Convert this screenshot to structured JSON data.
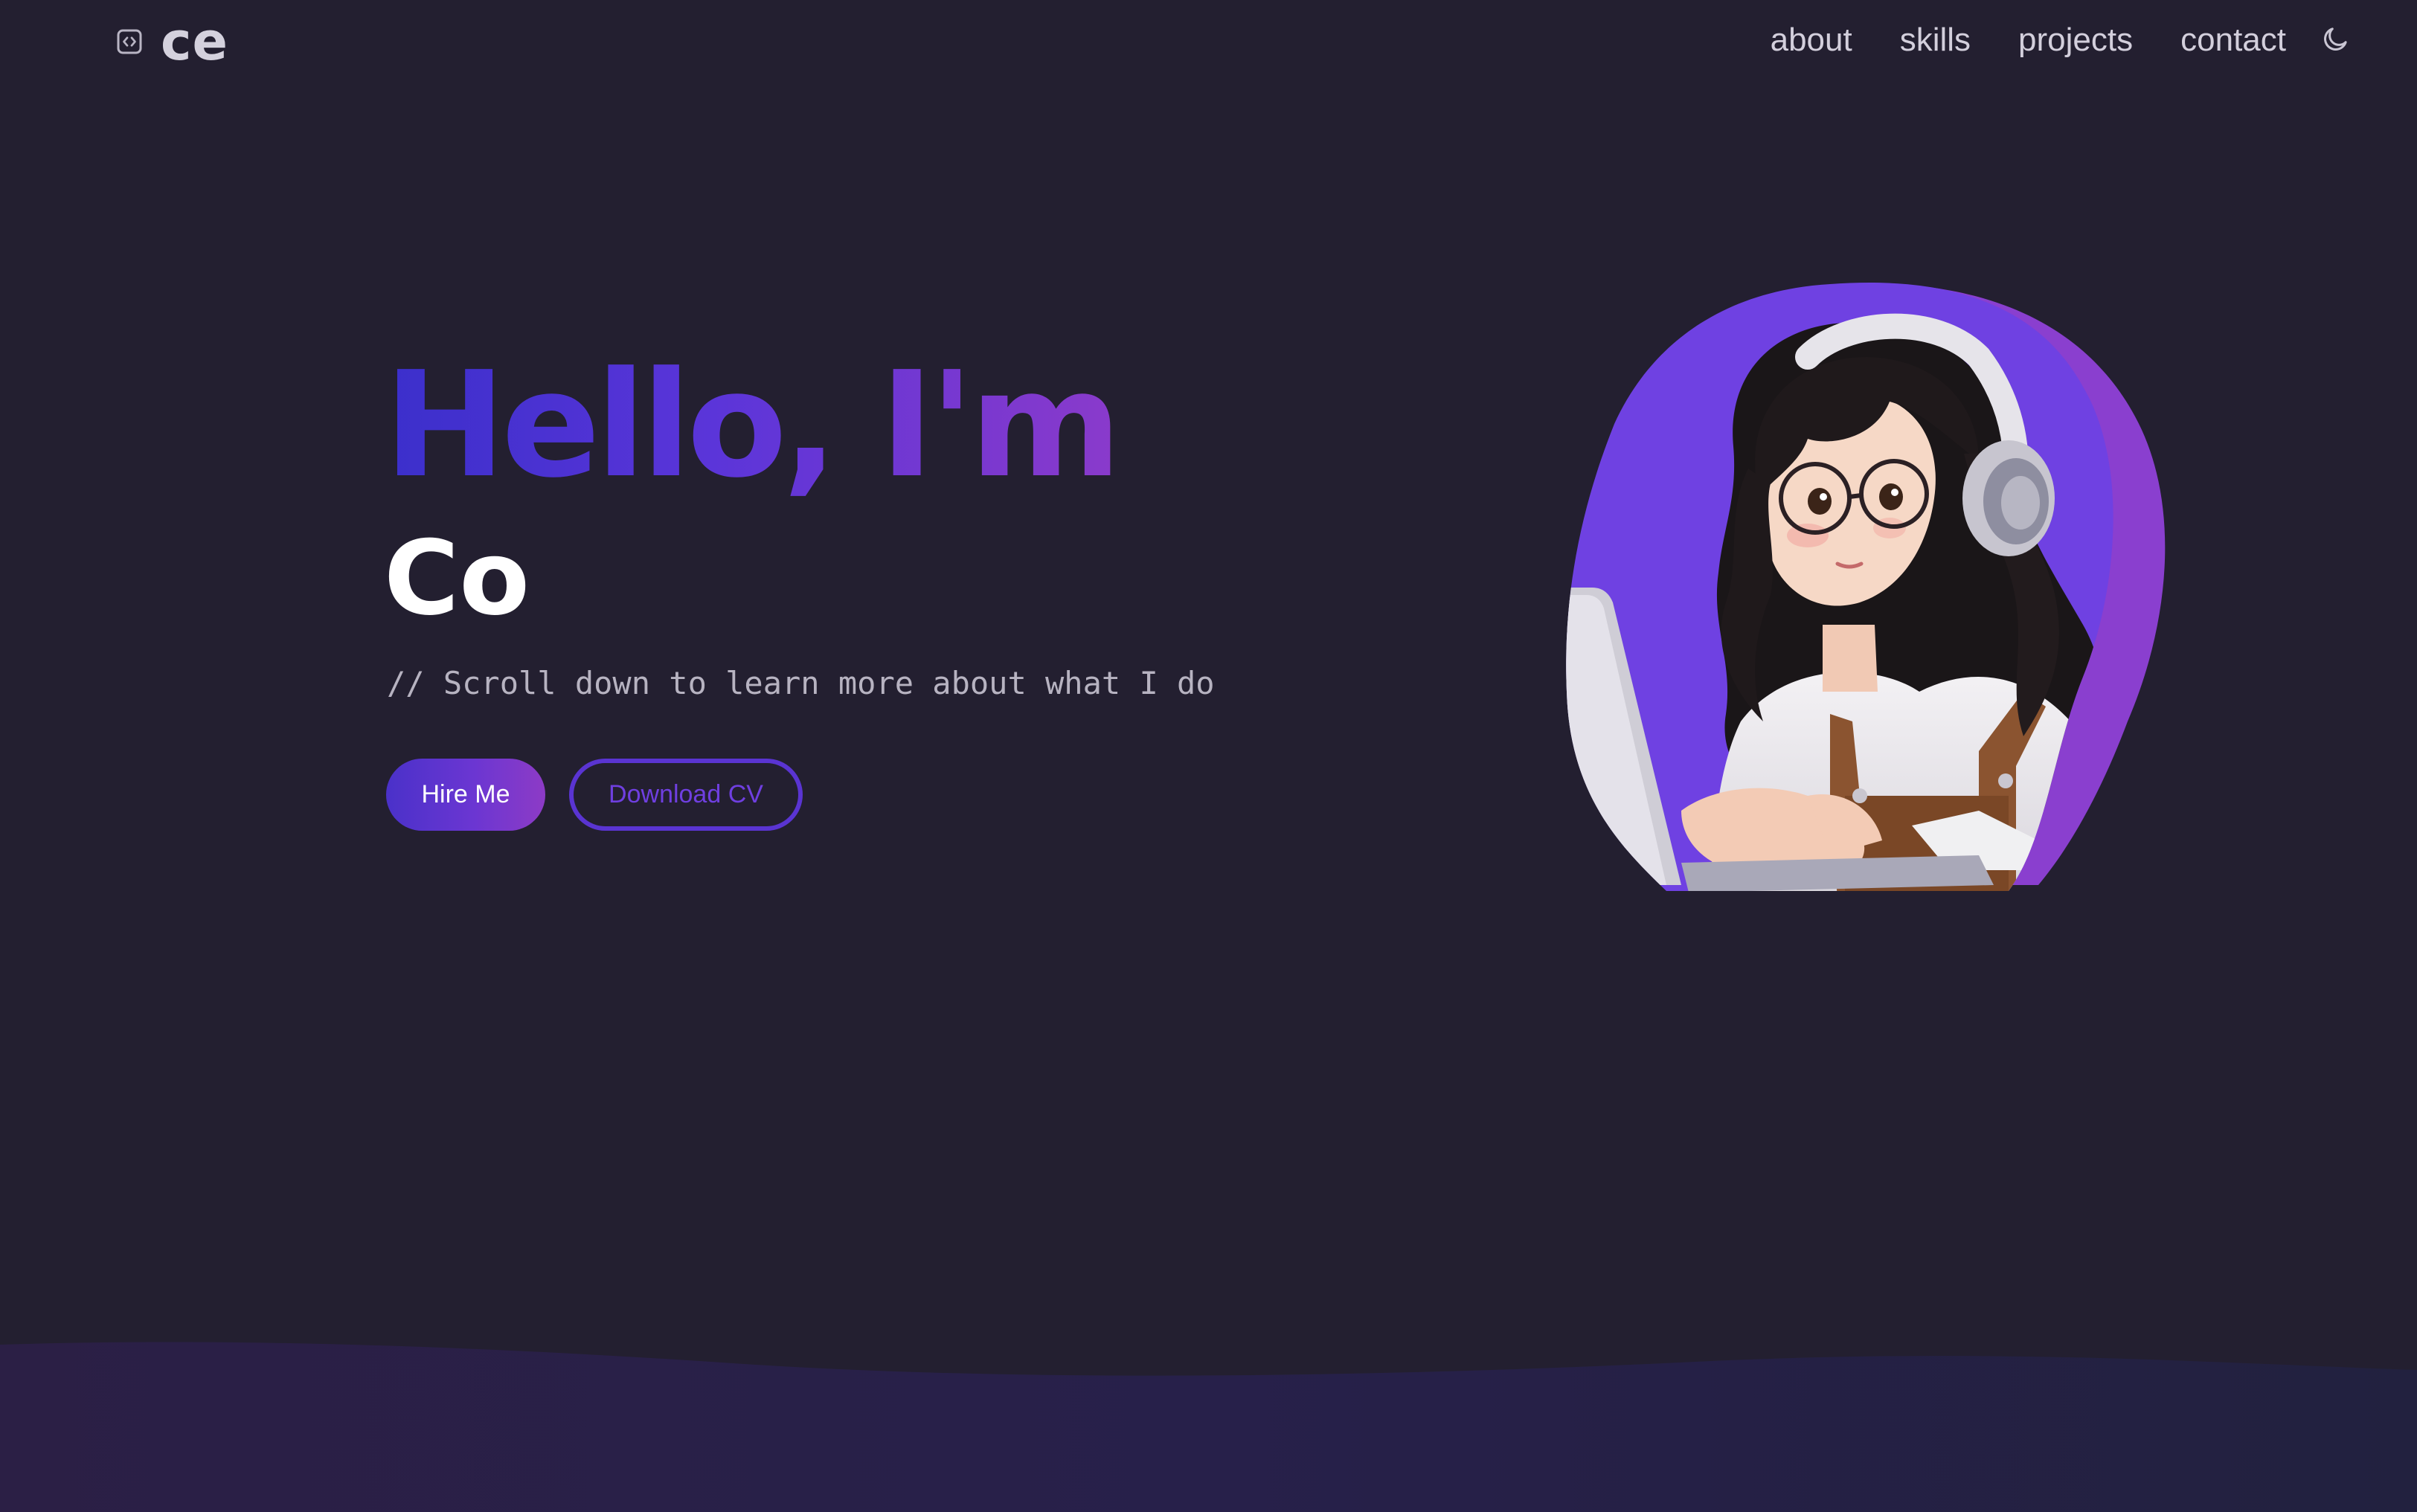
{
  "brand": {
    "logo_icon": "code-brackets-icon",
    "name": "ce"
  },
  "nav": {
    "links": [
      {
        "label": "about"
      },
      {
        "label": "skills"
      },
      {
        "label": "projects"
      },
      {
        "label": "contact"
      }
    ],
    "theme_toggle_icon": "moon-icon"
  },
  "hero": {
    "greeting": "Hello, I'm",
    "name": "Co",
    "subtitle": "// Scroll down to learn more about what I do",
    "primary_button": "Hire Me",
    "secondary_button": "Download CV",
    "avatar_alt": "girl-with-headphones-typing-on-laptop"
  },
  "colors": {
    "background": "#231f30",
    "accent_start": "#3b2fcb",
    "accent_end": "#8a3acb",
    "blob_primary": "#6f41e2",
    "blob_secondary": "#8a3fcf"
  }
}
